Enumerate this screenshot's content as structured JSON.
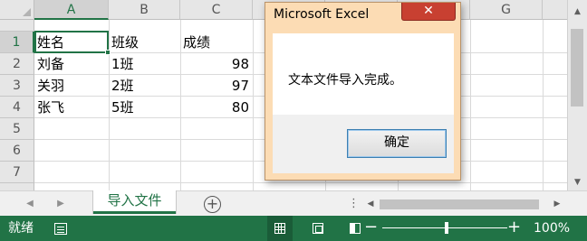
{
  "columns": [
    "A",
    "B",
    "C",
    "G"
  ],
  "rows": [
    "1",
    "2",
    "3",
    "4",
    "5",
    "6",
    "7"
  ],
  "cells": {
    "header": [
      "姓名",
      "班级",
      "成绩"
    ],
    "data": [
      [
        "刘备",
        "1班",
        "98"
      ],
      [
        "关羽",
        "2班",
        "97"
      ],
      [
        "张飞",
        "5班",
        "80"
      ]
    ]
  },
  "sheet_tab": "导入文件",
  "status_text": "就绪",
  "zoom_level": "100%",
  "zoom_slider_fraction": 0.5,
  "dialog": {
    "title": "Microsoft Excel",
    "close_glyph": "✕",
    "message": "文本文件导入完成。",
    "ok_label": "确定"
  },
  "colors": {
    "accent": "#217346",
    "dialog_frame": "#fcdcb4",
    "close_button": "#c84031"
  }
}
